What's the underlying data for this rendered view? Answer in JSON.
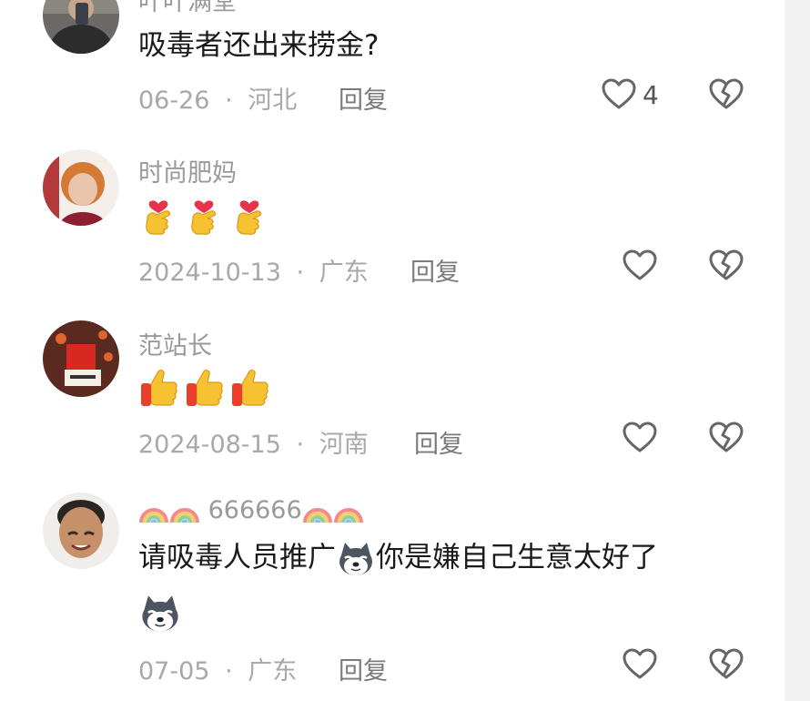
{
  "comments": [
    {
      "username": "叶叶满堂",
      "text": "吸毒者还出来捞金?",
      "date": "06-26",
      "location": "河北",
      "reply_label": "回复",
      "like_count": "4"
    },
    {
      "username": "时尚肥妈",
      "emoji": "finger-heart-emoji",
      "date": "2024-10-13",
      "location": "广东",
      "reply_label": "回复"
    },
    {
      "username": "范站长",
      "emoji": "thumbs-up-emoji",
      "date": "2024-08-15",
      "location": "河南",
      "reply_label": "回复"
    },
    {
      "username": "666666",
      "username_decoration": "rainbow-emoji",
      "text_before_emoji": "请吸毒人员推广",
      "text_after_emoji": "你是嫌自己生意太好了",
      "emoji": "husky-dog-emoji",
      "date": "07-05",
      "location": "广东",
      "reply_label": "回复"
    }
  ],
  "separator": "·",
  "colors": {
    "meta_text": "#a8a8a8",
    "username_text": "#9a9a9a",
    "content_text": "#1a1a1a",
    "icon_stroke": "#666666"
  }
}
